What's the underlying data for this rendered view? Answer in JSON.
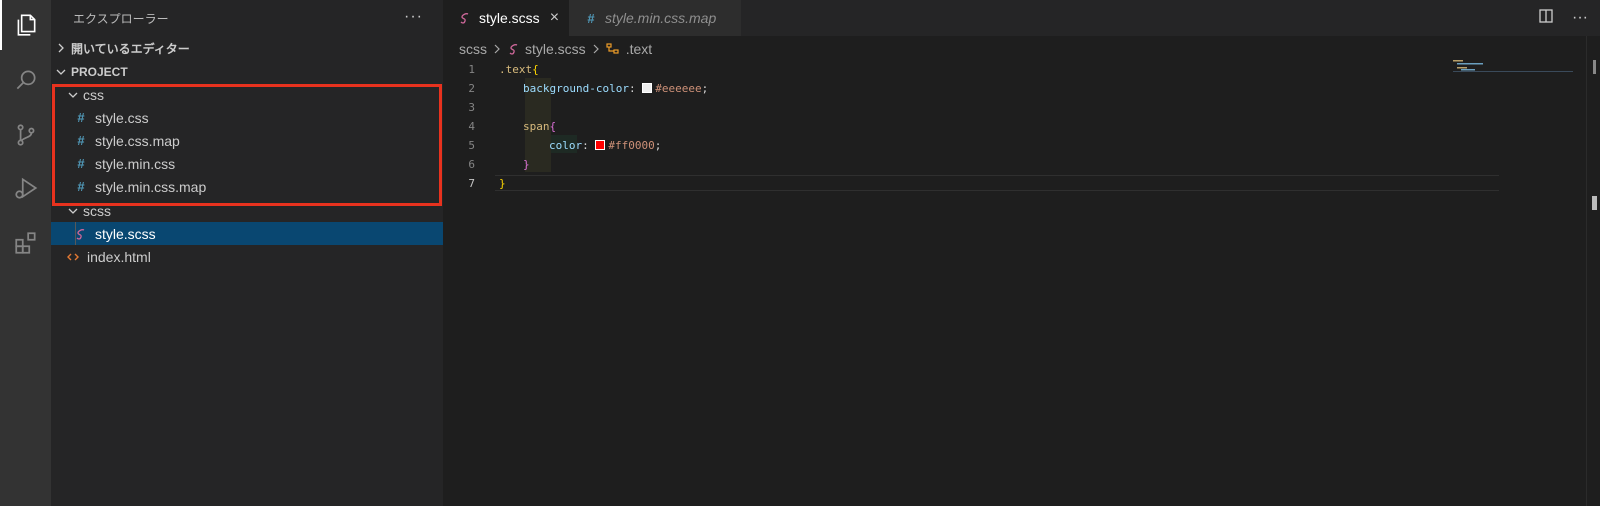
{
  "explorer": {
    "title": "エクスプローラー",
    "more": "···",
    "open_editors": "開いているエディター",
    "project": "PROJECT"
  },
  "tree": {
    "css_folder": "css",
    "css_files": [
      "style.css",
      "style.css.map",
      "style.min.css",
      "style.min.css.map"
    ],
    "scss_folder": "scss",
    "scss_file": "style.scss",
    "html_file": "index.html"
  },
  "tabs": [
    {
      "label": "style.scss",
      "close": "×"
    },
    {
      "label": "style.min.css.map"
    }
  ],
  "tab_actions": {
    "more": "···"
  },
  "breadcrumb": [
    "scss",
    "style.scss",
    ".text"
  ],
  "code": {
    "line_numbers": [
      "1",
      "2",
      "3",
      "4",
      "5",
      "6",
      "7"
    ],
    "selector": ".text",
    "open_brace": "{",
    "prop1": "background-color",
    "colon": ":",
    "val1": "#eeeeee",
    "semi": ";",
    "span": "span",
    "prop2": "color",
    "val2": "#ff0000",
    "close_brace": "}"
  },
  "colors": {
    "swatch1": "#eeeeee",
    "swatch2": "#ff0000",
    "accent_selected": "#094771",
    "highlight_box": "#e8321e"
  }
}
